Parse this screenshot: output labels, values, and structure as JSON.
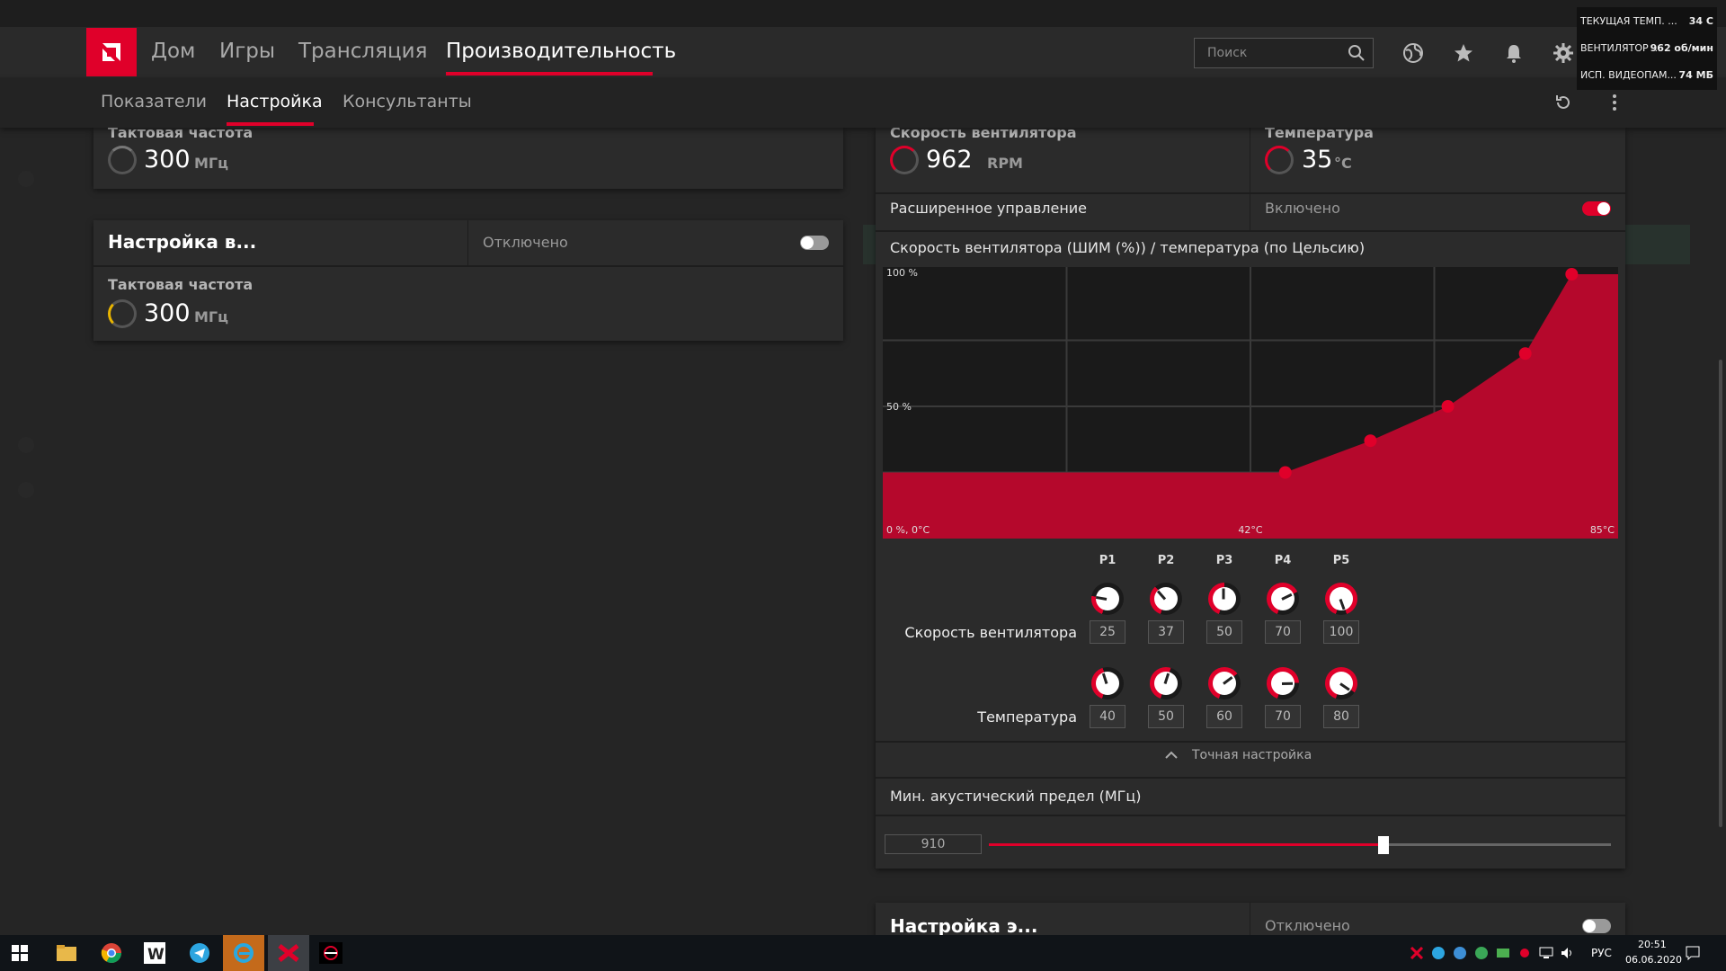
{
  "nav": {
    "tabs": [
      "Дом",
      "Игры",
      "Трансляция",
      "Производительность"
    ],
    "search_placeholder": "Поиск"
  },
  "subnav": {
    "tabs": [
      "Показатели",
      "Настройка",
      "Консультанты"
    ]
  },
  "overlay": {
    "rows": [
      {
        "label": "ТЕКУЩАЯ ТЕМП. ...",
        "value": "34 С"
      },
      {
        "label": "ВЕНТИЛЯТОР ...",
        "value": "962 об/мин"
      },
      {
        "label": "ИСП. ВИДЕОПАМ...",
        "value": "74 МБ"
      }
    ]
  },
  "left": {
    "clock1_label": "Тактовая частота",
    "clock1_value": "300",
    "clock1_unit": "МГц",
    "tuning_title": "Настройка в...",
    "tuning_state": "Отключено",
    "clock2_label": "Тактовая частота",
    "clock2_value": "300",
    "clock2_unit": "МГц"
  },
  "right": {
    "fan_label": "Скорость вентилятора",
    "fan_value": "962",
    "fan_unit": "RPM",
    "temp_label": "Температура",
    "temp_value": "35",
    "temp_unit": "°C",
    "adv_label": "Расширенное управление",
    "adv_state": "Включено",
    "chart_title": "Скорость вентилятора (ШИМ (%)) / температура (по Цельсию)",
    "p_labels": [
      "P1",
      "P2",
      "P3",
      "P4",
      "P5"
    ],
    "fan_row_label": "Скорость вентилятора",
    "temp_row_label": "Температура",
    "fan_values": [
      "25",
      "37",
      "50",
      "70",
      "100"
    ],
    "temp_values": [
      "40",
      "50",
      "60",
      "70",
      "80"
    ],
    "fine_tune": "Точная настройка",
    "acoustic_label": "Мин. акустический предел (МГц)",
    "acoustic_value": "910",
    "acoustic_fraction": 0.635,
    "bottom_title": "Настройка э...",
    "bottom_state": "Отключено"
  },
  "chart_data": {
    "type": "area",
    "x": [
      0,
      52,
      63,
      73,
      83,
      89,
      95
    ],
    "y": [
      25,
      25,
      37,
      50,
      70,
      100,
      100
    ],
    "tick_labels": [
      "0 %, 0°C",
      "42°C",
      "85°C"
    ],
    "y_tick_labels": [
      "100 %",
      "50 %"
    ],
    "x_range": [
      0,
      95
    ],
    "y_range": [
      0,
      100
    ],
    "color": "#b5082c",
    "grid": true
  },
  "colors": {
    "accent": "#e0002a",
    "bg": "#252525",
    "card": "#2b2b2b"
  },
  "taskbar": {
    "time": "20:51",
    "date": "06.06.2020",
    "lang": "РУС"
  }
}
